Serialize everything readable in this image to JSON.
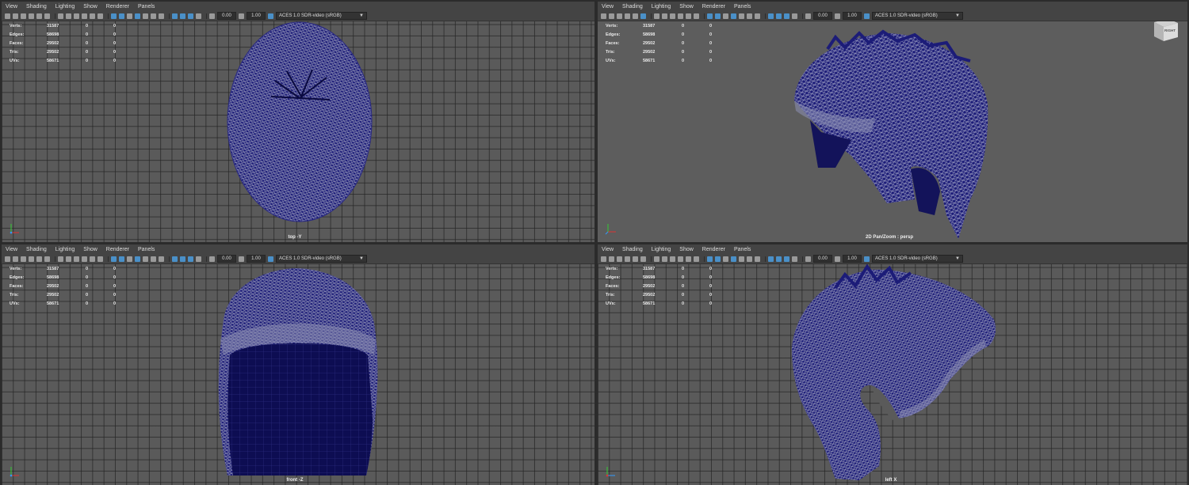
{
  "menu": [
    "View",
    "Shading",
    "Lighting",
    "Show",
    "Renderer",
    "Panels"
  ],
  "toolbar": {
    "exposure": "0.00",
    "gamma": "1.00",
    "color_space": "ACES 1.0 SDR-video (sRGB)"
  },
  "hud": {
    "rows": [
      {
        "label": "Verts:",
        "value": "31587",
        "sel1": "0",
        "sel2": "0"
      },
      {
        "label": "Edges:",
        "value": "58698",
        "sel1": "0",
        "sel2": "0"
      },
      {
        "label": "Faces:",
        "value": "29502",
        "sel1": "0",
        "sel2": "0"
      },
      {
        "label": "Tris:",
        "value": "29502",
        "sel1": "0",
        "sel2": "0"
      },
      {
        "label": "UVs:",
        "value": "58671",
        "sel1": "0",
        "sel2": "0"
      }
    ]
  },
  "viewports": {
    "top": {
      "camera_label": "top -Y"
    },
    "persp": {
      "camera_label": "2D Pan/Zoom : persp",
      "viewcube_label": "RIGHT"
    },
    "front": {
      "camera_label": "front -Z"
    },
    "left": {
      "camera_label": "left X"
    }
  },
  "colors": {
    "mesh_fill": "#1c1c78",
    "wire": "#8d8fb4",
    "panel_bg": "#5a5a5a",
    "toolbar_bg": "#444444"
  }
}
